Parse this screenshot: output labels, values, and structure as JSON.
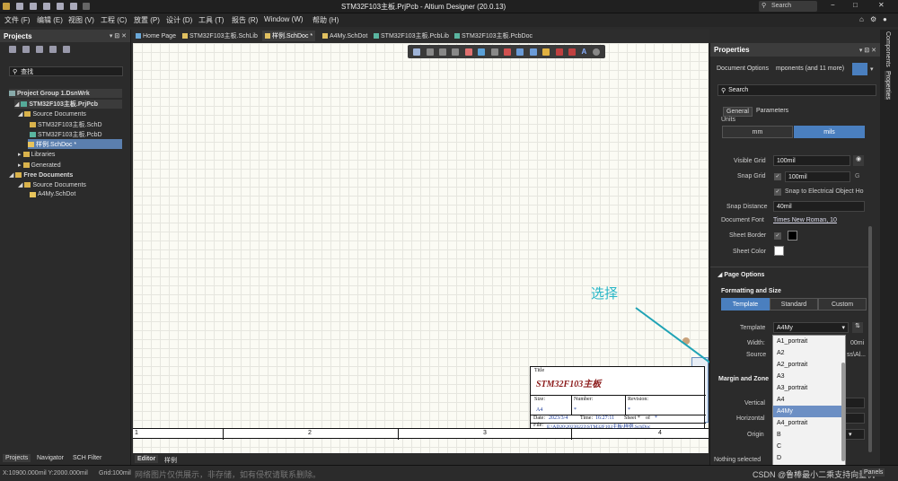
{
  "window": {
    "title": "STM32F103主板.PrjPcb - Altium Designer (20.0.13)",
    "search_placeholder": "Search"
  },
  "menu": [
    "文件 (F)",
    "编辑 (E)",
    "视图 (V)",
    "工程 (C)",
    "放置 (P)",
    "设计 (D)",
    "工具 (T)",
    "报告 (R)",
    "Window (W)",
    "帮助 (H)"
  ],
  "tabs": [
    {
      "label": "Home Page"
    },
    {
      "label": "STM32F103主板.SchLib"
    },
    {
      "label": "样例.SchDoc *"
    },
    {
      "label": "A4My.SchDot"
    },
    {
      "label": "STM32F103主板.PcbLib"
    },
    {
      "label": "STM32F103主板.PcbDoc"
    }
  ],
  "projects": {
    "title": "Projects",
    "search_placeholder": "查找",
    "tree": [
      {
        "label": "Project Group 1.DsnWrk"
      },
      {
        "label": "STM32F103主板.PrjPcb"
      },
      {
        "label": "Source Documents"
      },
      {
        "label": "STM32F103主板.SchD"
      },
      {
        "label": "STM32F103主板.PcbD"
      },
      {
        "label": "样例.SchDoc *"
      },
      {
        "label": "Libraries"
      },
      {
        "label": "Generated"
      },
      {
        "label": "Free Documents"
      },
      {
        "label": "Source Documents"
      },
      {
        "label": "A4My.SchDot"
      }
    ],
    "bottom_tabs": [
      "Projects",
      "Navigator",
      "SCH Filter"
    ]
  },
  "editor_tabs": [
    "Editor",
    "样例"
  ],
  "canvas": {
    "annotation": "选择",
    "zones": [
      "1",
      "2",
      "3",
      "4"
    ],
    "title_block": {
      "title_label": "Title",
      "title_value": "STM32F103主板",
      "size_label": "Size:",
      "size_value": "A4",
      "number_label": "Number:",
      "number_value": "*",
      "revision_label": "Revision:",
      "revision_value": "*",
      "date_label": "Date:",
      "date_value": "2023/3/4",
      "time_label": "Time:",
      "time_value": "16:27:11",
      "sheet_label": "Sheet *",
      "of_label": "of",
      "of_value": "*",
      "file_label": "File:",
      "file_value": "E:\\AD20\\20230223\\STM32F103主板\\样例.SchDoc"
    }
  },
  "properties": {
    "title": "Properties",
    "doc_options": "Document Options",
    "components_filter": "mponents (and 11 more)",
    "search_placeholder": "Search",
    "tab_general": "General",
    "tab_parameters": "Parameters",
    "units_label": "Units",
    "unit_mm": "mm",
    "unit_mils": "mils",
    "visible_grid_label": "Visible Grid",
    "visible_grid_value": "100mil",
    "snap_grid_label": "Snap Grid",
    "snap_grid_value": "100mil",
    "snap_grid_key": "G",
    "snap_electrical": "Snap to Electrical Object Ho",
    "snap_distance_label": "Snap Distance",
    "snap_distance_value": "40mil",
    "doc_font_label": "Document Font",
    "doc_font_value": "Times New Roman, 10",
    "sheet_border_label": "Sheet Border",
    "sheet_color_label": "Sheet Color",
    "page_options": "Page Options",
    "formatting_size": "Formatting and Size",
    "seg_template": "Template",
    "seg_standard": "Standard",
    "seg_custom": "Custom",
    "template_label": "Template",
    "template_value": "A4My",
    "width_label": "Width:",
    "width_value": "00mi",
    "source_label": "Source",
    "source_value": "ss\\Al...",
    "margin_zones": "Margin and Zone",
    "vertical_label": "Vertical",
    "horizontal_label": "Horizontal",
    "origin_label": "Origin",
    "nothing_selected": "Nothing selected",
    "panels_button": "Panels"
  },
  "template_options": [
    "A1_portrait",
    "A2",
    "A2_portrait",
    "A3",
    "A3_portrait",
    "A4",
    "A4My",
    "A4_portrait",
    "B",
    "C",
    "D"
  ],
  "template_selected": "A4My",
  "right_strip": [
    "Components",
    "Properties"
  ],
  "status": {
    "coords": "X:10900.000mil Y:2000.000mil",
    "grid": "Grid:100mil",
    "watermark": "网络图片仅供展示，非存储，如有侵权请联系删除。",
    "credit": "CSDN @鲁棒最小二乘支持向量机"
  },
  "colors": {
    "accent": "#4a7fbf",
    "arrow": "#1fa3b5",
    "annotation": "#27b6c7"
  }
}
